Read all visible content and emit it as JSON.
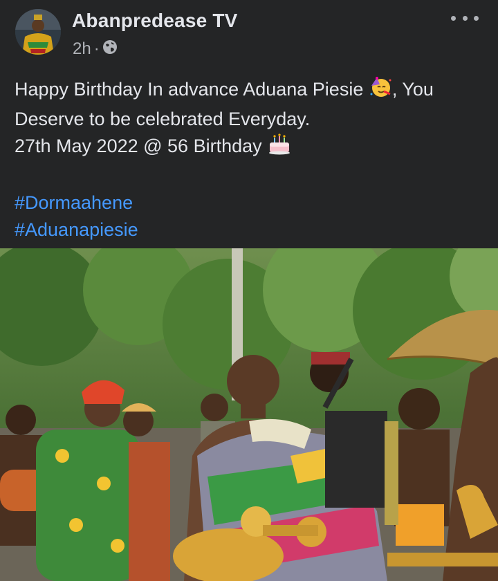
{
  "post": {
    "author": "Abanpredease TV",
    "timestamp": "2h",
    "separator": "·",
    "privacy_icon": "globe-icon",
    "menu_icon": "more-options-icon",
    "line1_before": "Happy Birthday In advance Aduana Piesie ",
    "line1_emoji": "partying-face-emoji",
    "line1_after": ", You",
    "line2": "Deserve to be celebrated Everyday.",
    "line3": "27th May 2022 @ 56 Birthday ",
    "line3_emoji": "birthday-cake-emoji",
    "hashtags": [
      "#Dormaahene",
      "#Aduanapiesie"
    ]
  },
  "colors": {
    "background": "#242526",
    "text": "#e4e6eb",
    "secondary_text": "#b0b3b8",
    "link": "#4599ff"
  }
}
